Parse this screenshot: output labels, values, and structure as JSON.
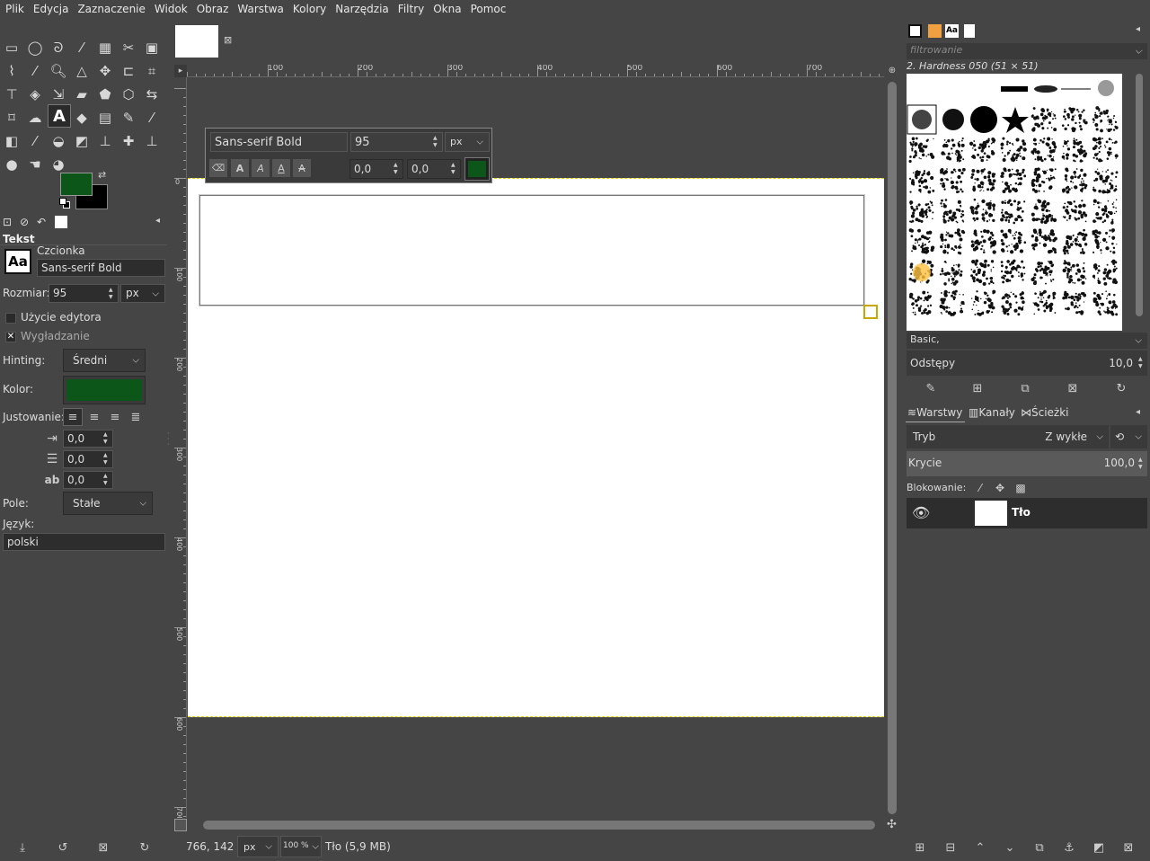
{
  "menu": [
    "Plik",
    "Edycja",
    "Zaznaczenie",
    "Widok",
    "Obraz",
    "Warstwa",
    "Kolory",
    "Narzędzia",
    "Filtry",
    "Okna",
    "Pomoc"
  ],
  "colors": {
    "fg": "#0b5618",
    "bg": "#000000",
    "panel": "#454545",
    "dark": "#2d2d2d",
    "guide": "#e6d000"
  },
  "tool_options": {
    "title": "Tekst",
    "font_label": "Czcionka",
    "font_value": "Sans-serif Bold",
    "size_label": "Rozmiar:",
    "size_value": "95",
    "size_unit": "px",
    "use_editor": "Użycie edytora",
    "antialias": "Wygładzanie",
    "hinting_label": "Hinting:",
    "hinting_value": "Średni",
    "color_label": "Kolor:",
    "justify_label": "Justowanie:",
    "indent": "0,0",
    "line_spacing": "0,0",
    "letter_spacing": "0,0",
    "box_label": "Pole:",
    "box_value": "Stałe",
    "lang_label": "Język:",
    "lang_value": "polski"
  },
  "text_toolbar": {
    "font": "Sans-serif Bold",
    "size": "95",
    "unit": "px",
    "baseline": "0,0",
    "kerning": "0,0"
  },
  "ruler": {
    "h_ticks": [
      "100",
      "200",
      "300",
      "400",
      "500",
      "600",
      "700"
    ],
    "v_ticks": [
      "0",
      "100",
      "200",
      "300",
      "400",
      "500",
      "600",
      "700"
    ]
  },
  "status": {
    "coords": "766, 142",
    "unit": "px",
    "zoom": "100 %",
    "layer_info": "Tło (5,9 MB)"
  },
  "brushes": {
    "filter_placeholder": "filtrowanie",
    "current": "2. Hardness 050 (51 × 51)",
    "tag": "Basic,",
    "spacing_label": "Odstępy",
    "spacing_value": "10,0"
  },
  "layers": {
    "tabs": [
      "Warstwy",
      "Kanały",
      "Ścieżki"
    ],
    "mode_label": "Tryb",
    "mode_value": "Z wykłe",
    "opacity_label": "Krycie",
    "opacity_value": "100,0",
    "lock_label": "Blokowanie:",
    "layer_name": "Tło"
  }
}
